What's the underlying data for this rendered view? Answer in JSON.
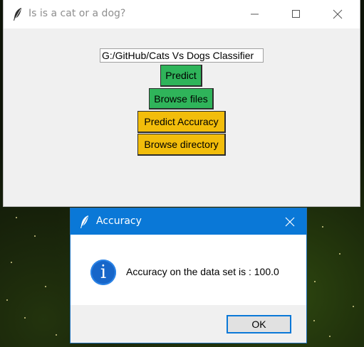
{
  "main_window": {
    "title": "Is is a cat or a dog?",
    "path_entry_value": "G:/GitHub/Cats Vs Dogs Classifier",
    "buttons": {
      "predict": "Predict",
      "browse_files": "Browse files",
      "predict_accuracy": "Predict Accuracy",
      "browse_directory": "Browse directory"
    },
    "button_colors": {
      "green": "#2fb45a",
      "yellow": "#f2bd0b"
    },
    "icons": [
      "feather-icon",
      "minimize-icon",
      "maximize-icon",
      "close-icon"
    ]
  },
  "dialog": {
    "title": "Accuracy",
    "message": "Accuracy on the data set is : 100.0",
    "ok_label": "OK",
    "info_glyph": "i",
    "titlebar_color": "#0a78d7",
    "icons": [
      "feather-icon",
      "close-icon",
      "info-icon"
    ]
  }
}
